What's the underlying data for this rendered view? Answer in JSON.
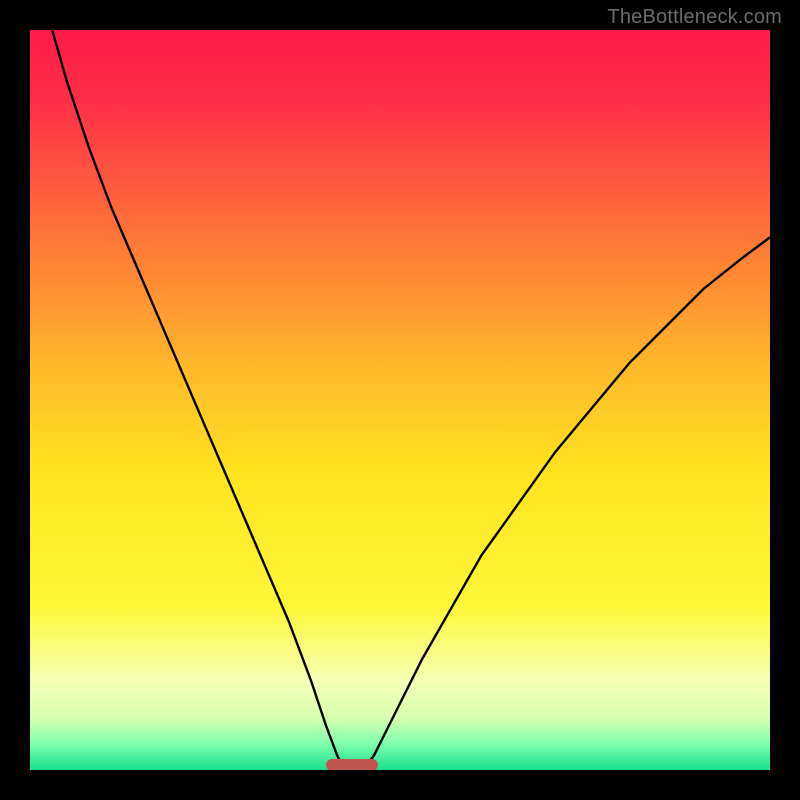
{
  "watermark": "TheBottleneck.com",
  "colors": {
    "frame": "#000000",
    "curve": "#000000",
    "marker": "#c1544f",
    "gradient_stops": [
      {
        "offset": 0.0,
        "color": "#ff1a4a"
      },
      {
        "offset": 0.1,
        "color": "#ff2f47"
      },
      {
        "offset": 0.25,
        "color": "#ff6a3a"
      },
      {
        "offset": 0.45,
        "color": "#ffb62a"
      },
      {
        "offset": 0.6,
        "color": "#ffe41e"
      },
      {
        "offset": 0.78,
        "color": "#fdf838"
      },
      {
        "offset": 0.88,
        "color": "#f6ffb5"
      },
      {
        "offset": 0.93,
        "color": "#d6ffb0"
      },
      {
        "offset": 0.965,
        "color": "#7dffad"
      },
      {
        "offset": 1.0,
        "color": "#18e08d"
      }
    ]
  },
  "chart_data": {
    "type": "line",
    "title": "",
    "xlabel": "",
    "ylabel": "",
    "xlim": [
      0,
      100
    ],
    "ylim": [
      0,
      100
    ],
    "marker": {
      "x_start": 40,
      "x_end": 47,
      "y": 0
    },
    "series": [
      {
        "name": "left-curve",
        "x": [
          3,
          5,
          8,
          11,
          14,
          17,
          20,
          23,
          26,
          29,
          32,
          35,
          38,
          40,
          41.5,
          42.5
        ],
        "values": [
          100,
          93,
          84,
          76,
          69,
          62,
          55,
          48,
          41,
          34,
          27,
          20,
          12,
          6,
          2,
          0
        ]
      },
      {
        "name": "right-curve",
        "x": [
          45,
          46.5,
          48,
          50,
          53,
          57,
          61,
          66,
          71,
          76,
          81,
          86,
          91,
          96,
          100
        ],
        "values": [
          0,
          2,
          5,
          9,
          15,
          22,
          29,
          36,
          43,
          49,
          55,
          60,
          65,
          69,
          72
        ]
      }
    ]
  }
}
